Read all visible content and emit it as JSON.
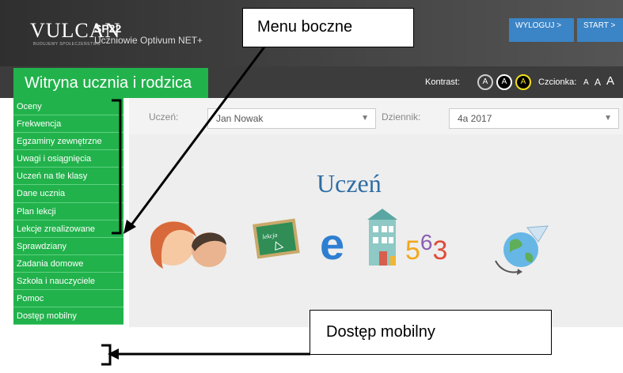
{
  "header": {
    "logo_text": "VULCAN",
    "logo_tagline": "BUDUJEMY SPOŁECZEŃSTWO",
    "school": "SP22",
    "app_name": "Uczniowie Optivum NET+",
    "logout_label": "WYLOGUJ >",
    "start_label": "START >"
  },
  "site": {
    "title": "Witryna ucznia i rodzica",
    "contrast_label": "Kontrast:",
    "contrast_options": [
      "A",
      "A",
      "A"
    ],
    "font_label": "Czcionka:",
    "font_sizes": [
      "A",
      "A",
      "A"
    ]
  },
  "filters": {
    "student_label": "Uczeń:",
    "student_value": "Jan Nowak",
    "journal_label": "Dziennik:",
    "journal_value": "4a 2017"
  },
  "main": {
    "heading": "Uczeń"
  },
  "sidebar": {
    "items": [
      {
        "label": "Oceny"
      },
      {
        "label": "Frekwencja"
      },
      {
        "label": "Egzaminy zewnętrzne"
      },
      {
        "label": "Uwagi i osiągnięcia"
      },
      {
        "label": "Uczeń na tle klasy"
      },
      {
        "label": "Dane ucznia"
      },
      {
        "label": "Plan lekcji"
      },
      {
        "label": "Lekcje zrealizowane"
      },
      {
        "label": "Sprawdziany"
      },
      {
        "label": "Zadania domowe"
      },
      {
        "label": "Szkoła i nauczyciele"
      },
      {
        "label": "Pomoc"
      },
      {
        "label": "Dostęp mobilny"
      }
    ]
  },
  "annotations": {
    "callout_menu": "Menu boczne",
    "callout_mobile": "Dostęp mobilny"
  },
  "icons": {
    "numbers_text": "563",
    "board_text": "lekcja"
  },
  "colors": {
    "green": "#22b24c",
    "blue_button": "#3b84c6",
    "heading_blue": "#2e6da4",
    "contrast_yellow": "#f2e21b"
  }
}
